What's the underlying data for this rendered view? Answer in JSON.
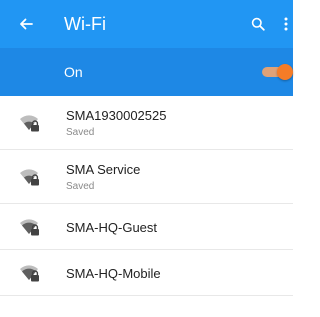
{
  "app_bar": {
    "title": "Wi-Fi",
    "back_icon": "arrow-left-icon",
    "search_icon": "search-icon",
    "more_icon": "more-vertical-icon",
    "background": "#2196f3"
  },
  "master_switch": {
    "label": "On",
    "state": true,
    "background": "#1e88e5",
    "accent": "#f57c27"
  },
  "networks": [
    {
      "ssid": "SMA1930002525",
      "status": "Saved",
      "secured": true,
      "icon": "wifi-lock-icon"
    },
    {
      "ssid": "SMA Service",
      "status": "Saved",
      "secured": true,
      "icon": "wifi-lock-icon"
    },
    {
      "ssid": "SMA-HQ-Guest",
      "status": "",
      "secured": true,
      "icon": "wifi-lock-icon"
    },
    {
      "ssid": "SMA-HQ-Mobile",
      "status": "",
      "secured": true,
      "icon": "wifi-lock-icon"
    }
  ]
}
